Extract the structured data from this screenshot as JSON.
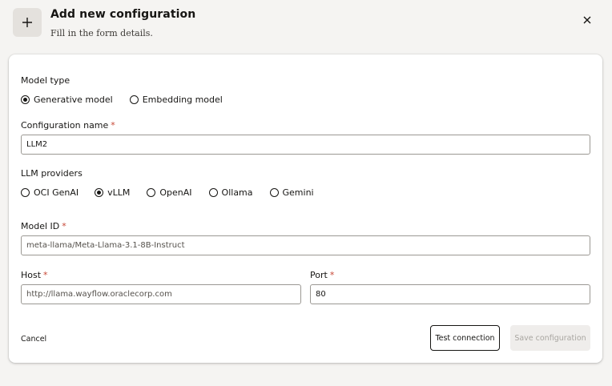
{
  "header": {
    "title": "Add new configuration",
    "subtitle": "Fill in the form details.",
    "add_icon": "plus-icon",
    "close_icon": "close-icon"
  },
  "form": {
    "model_type": {
      "label": "Model type",
      "options": [
        {
          "label": "Generative model",
          "selected": true
        },
        {
          "label": "Embedding model",
          "selected": false
        }
      ]
    },
    "configuration_name": {
      "label": "Configuration name",
      "required_mark": "*",
      "value": "LLM2"
    },
    "llm_providers": {
      "label": "LLM providers",
      "options": [
        {
          "label": "OCI GenAI",
          "selected": false
        },
        {
          "label": "vLLM",
          "selected": true
        },
        {
          "label": "OpenAI",
          "selected": false
        },
        {
          "label": "Ollama",
          "selected": false
        },
        {
          "label": "Gemini",
          "selected": false
        }
      ]
    },
    "model_id": {
      "label": "Model ID",
      "required_mark": "*",
      "value": "meta-llama/Meta-Llama-3.1-8B-Instruct"
    },
    "host": {
      "label": "Host",
      "required_mark": "*",
      "value": "http://llama.wayflow.oraclecorp.com"
    },
    "port": {
      "label": "Port",
      "required_mark": "*",
      "value": "80"
    }
  },
  "actions": {
    "cancel_label": "Cancel",
    "test_label": "Test connection",
    "save_label": "Save configuration"
  },
  "colors": {
    "required": "#c74634",
    "background": "#f5f4f2",
    "card": "#ffffff",
    "disabled_button": "#efedeb"
  }
}
